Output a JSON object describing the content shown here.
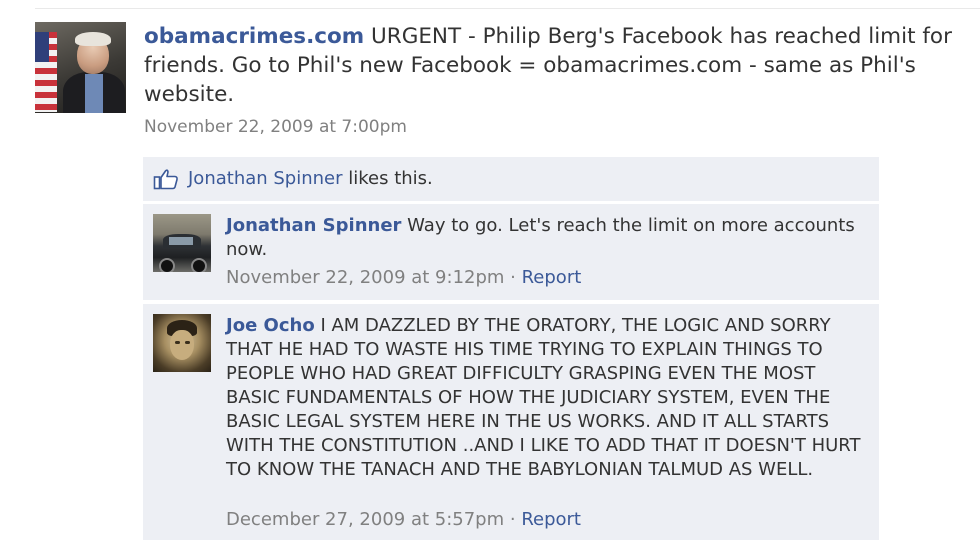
{
  "post": {
    "source_name": "obamacrimes.com",
    "message": "URGENT - Philip Berg's Facebook has reached limit for friends. Go to Phil's new Facebook = obamacrimes.com - same as Phil's website.",
    "timestamp": "November 22, 2009 at 7:00pm"
  },
  "likes": {
    "liker": "Jonathan Spinner",
    "suffix": " likes this."
  },
  "comments": [
    {
      "author": "Jonathan Spinner",
      "text": "Way to go. Let's reach the limit on more accounts now.",
      "timestamp": "November 22, 2009 at 9:12pm",
      "separator": " · ",
      "report_label": "Report"
    },
    {
      "author": "Joe Ocho",
      "text": "I AM DAZZLED BY THE ORATORY, THE LOGIC AND SORRY THAT HE HAD TO WASTE HIS TIME TRYING TO EXPLAIN THINGS TO PEOPLE WHO HAD GREAT DIFFICULTY GRASPING EVEN THE MOST BASIC FUNDAMENTALS OF HOW THE JUDICIARY SYSTEM, EVEN THE BASIC LEGAL SYSTEM HERE IN THE US WORKS. AND IT ALL STARTS WITH THE CONSTITUTION ..AND I LIKE TO ADD THAT IT DOESN'T HURT TO KNOW THE TANACH AND THE BABYLONIAN TALMUD AS WELL.",
      "timestamp": "December 27, 2009 at 5:57pm",
      "separator": " · ",
      "report_label": "Report"
    }
  ],
  "colors": {
    "link": "#3b5998",
    "comment_bg": "#edeff4",
    "muted": "#808080"
  },
  "icons": {
    "like": "thumbs-up-icon",
    "post_avatar": "profile-photo",
    "comment_avatars": [
      "car-photo",
      "vintage-portrait-photo"
    ]
  }
}
